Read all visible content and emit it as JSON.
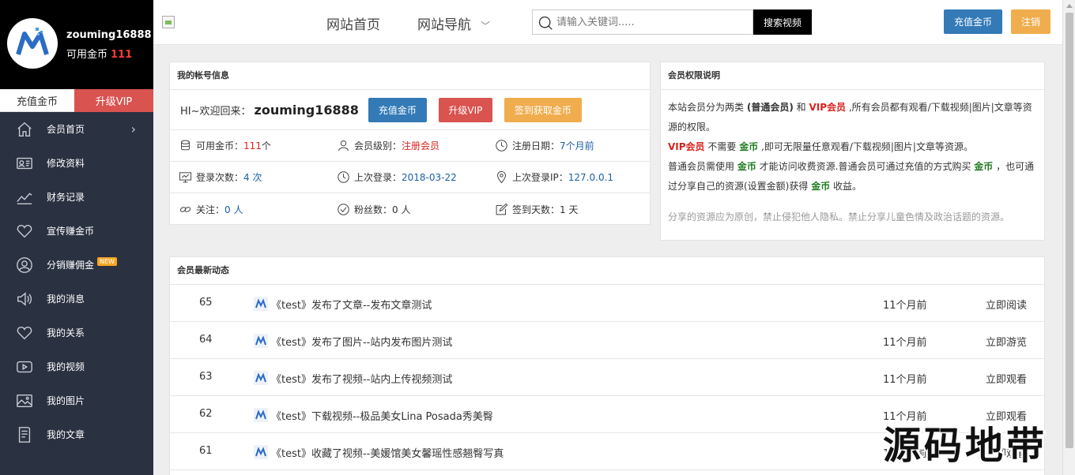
{
  "colors": {
    "sidebar_bg": "#2a3141",
    "primary": "#337ab7",
    "danger": "#d9534f",
    "warning": "#f0ad4e",
    "vip_red": "#d9231e",
    "gold_green": "#1e7b1e"
  },
  "sidebar": {
    "username": "zouming16888",
    "coins_label": "可用金币",
    "coins_value": "111",
    "recharge_label": "充值金币",
    "upgrade_label": "升级VIP",
    "items": [
      {
        "label": "会员首页",
        "icon": "home-icon"
      },
      {
        "label": "修改资料",
        "icon": "id-card-icon"
      },
      {
        "label": "财务记录",
        "icon": "chart-line-icon"
      },
      {
        "label": "宣传赚金币",
        "icon": "heart-icon"
      },
      {
        "label": "分销赚佣金",
        "icon": "user-icon",
        "badge": "NEW"
      },
      {
        "label": "我的消息",
        "icon": "speaker-icon"
      },
      {
        "label": "我的关系",
        "icon": "heart-icon"
      },
      {
        "label": "我的视频",
        "icon": "video-icon"
      },
      {
        "label": "我的图片",
        "icon": "image-icon"
      },
      {
        "label": "我的文章",
        "icon": "document-icon"
      }
    ]
  },
  "header": {
    "nav_home": "网站首页",
    "nav_guide": "网站导航",
    "search_placeholder": "请输入关键词.....",
    "search_button": "搜索视频",
    "recharge_button": "充值金币",
    "logout_button": "注销"
  },
  "account": {
    "title": "我的帐号信息",
    "greeting": "HI~欢迎回来：",
    "name": "zouming16888",
    "btn_recharge": "充值金币",
    "btn_upgrade": "升级VIP",
    "btn_signin": "签到获取金币",
    "coins_label": "可用金币：",
    "coins_value": "111",
    "coins_unit": " 个",
    "level_label": "会员级别：",
    "level_value": "注册会员",
    "reg_label": "注册日期：",
    "reg_value": "7个月前",
    "login_count_label": "登录次数：",
    "login_count_value": "4 次",
    "last_login_label": "上次登录：",
    "last_login_value": "2018-03-22",
    "last_ip_label": "上次登录IP：",
    "last_ip_value": "127.0.0.1",
    "follow_label": "关注：",
    "follow_value": "0 人",
    "fans_label": "粉丝数：",
    "fans_value": "0 人",
    "signin_days_label": "签到天数：",
    "signin_days_value": "1 天"
  },
  "rights": {
    "title": "会员权限说明",
    "p1_a": "本站会员分为两类 ",
    "p1_b": "(普通会员)",
    "p1_c": " 和 ",
    "p1_d": "VIP会员",
    "p1_e": " ,所有会员都有观看/下载视频|图片|文章等资源的权限。",
    "p2_a": "VIP会员",
    "p2_b": " 不需要 ",
    "p2_c": "金币",
    "p2_d": " ,即可无限量任意观看/下载视频|图片|文章等资源。",
    "p3_a": "普通会员需使用 ",
    "p3_b": "金币",
    "p3_c": " 才能访问收费资源.普通会员可通过充值的方式购买 ",
    "p3_d": "金币",
    "p3_e": " ，也可通过分享自己的资源(设置金额)获得 ",
    "p3_f": "金币",
    "p3_g": " 收益。",
    "note": "分享的资源应为原创，禁止侵犯他人隐私。禁止分享儿童色情及政治话题的资源。"
  },
  "feed": {
    "title": "会员最新动态",
    "rows": [
      {
        "id": "65",
        "text": "《test》发布了文章--发布文章测试",
        "time": "11个月前",
        "action": "立即阅读"
      },
      {
        "id": "64",
        "text": "《test》发布了图片--站内发布图片测试",
        "time": "11个月前",
        "action": "立即游览"
      },
      {
        "id": "63",
        "text": "《test》发布了视频--站内上传视频测试",
        "time": "11个月前",
        "action": "立即观看"
      },
      {
        "id": "62",
        "text": "《test》下载视频--极品美女Lina Posada秀美臀",
        "time": "11个月前",
        "action": "立即观看"
      },
      {
        "id": "61",
        "text": "《test》收藏了视频--美媛馆美女馨瑶性感翘臀写真",
        "time": "11个月前",
        "action": "立即观看"
      }
    ]
  },
  "watermark": "源码地带"
}
